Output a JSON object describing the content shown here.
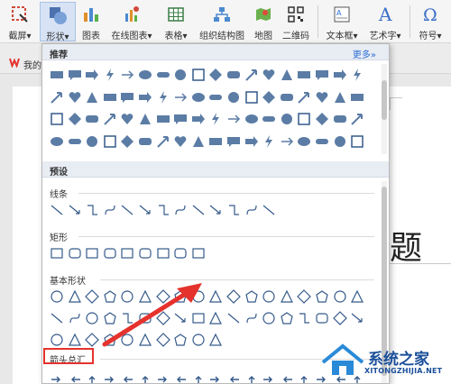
{
  "ribbon": {
    "screenshot_label": "截屏",
    "shape_label": "形状",
    "chart_label": "图表",
    "online_chart_label": "在线图表",
    "table_label": "表格",
    "org_chart_label": "组织结构图",
    "map_label": "地图",
    "qrcode_label": "二维码",
    "textbox_label": "文本框",
    "wordart_label": "艺术字",
    "symbol_label": "符号",
    "dropdown_glyph": "▾"
  },
  "tabbar": {
    "doc_tab_text": "我的"
  },
  "document": {
    "title_fragment": "题"
  },
  "panel": {
    "recommended_title": "推荐",
    "more_label": "更多»",
    "preset_title": "预设",
    "groups": {
      "lines": "线条",
      "rectangles": "矩形",
      "basic": "基本形状",
      "arrows": "箭头总汇"
    }
  },
  "colors": {
    "shape_fill": "#5b7ca5",
    "shape_outline": "#355a8a",
    "highlight_red": "#e5322d",
    "link_blue": "#2b6fd6",
    "watermark_blue": "#1b4f9a"
  },
  "watermark": {
    "title": "系统之家",
    "subtitle": "XITONGZHIJIA.NET"
  }
}
